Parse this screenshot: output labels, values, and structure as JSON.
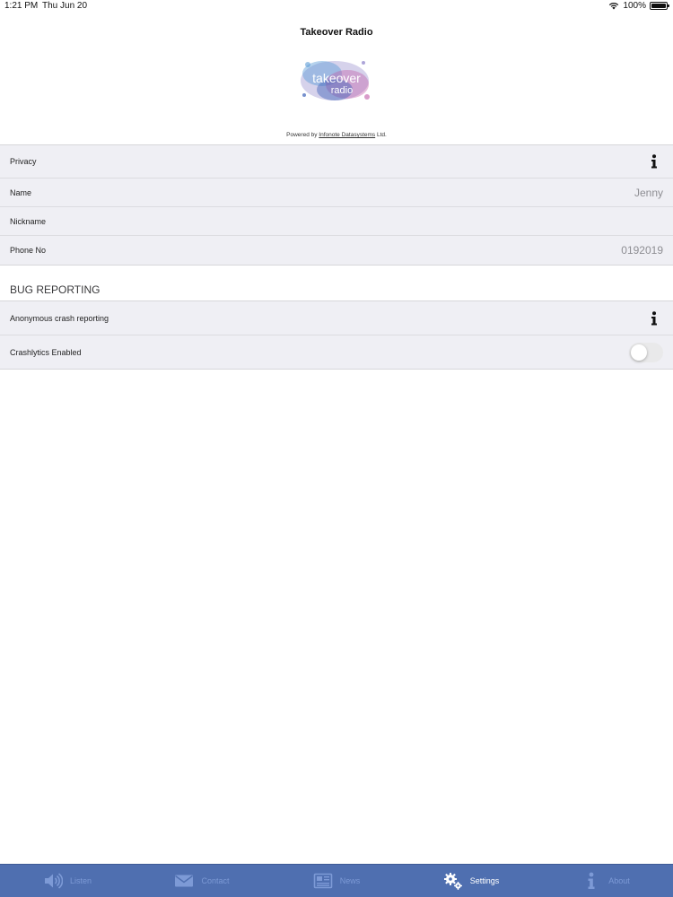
{
  "status_bar": {
    "time": "1:21 PM",
    "date": "Thu Jun 20",
    "battery": "100%"
  },
  "header": {
    "title": "Takeover Radio",
    "logo_text_line1": "takeover",
    "logo_text_line2": "radio",
    "powered_prefix": "Powered by ",
    "powered_link": "Infonote Datasystems",
    "powered_suffix": " Ltd."
  },
  "settings": {
    "privacy_label": "Privacy",
    "name_label": "Name",
    "name_value": "Jenny",
    "nickname_label": "Nickname",
    "nickname_value": "",
    "phone_label": "Phone No",
    "phone_value": "0192019"
  },
  "bug_reporting": {
    "section_title": "BUG REPORTING",
    "anonymous_label": "Anonymous crash reporting",
    "crashlytics_label": "Crashlytics Enabled",
    "crashlytics_enabled": false
  },
  "tab_bar": {
    "active_tab": "Settings",
    "tabs": [
      {
        "label": "Listen",
        "icon": "speaker-icon"
      },
      {
        "label": "Contact",
        "icon": "envelope-icon"
      },
      {
        "label": "News",
        "icon": "newspaper-icon"
      },
      {
        "label": "Settings",
        "icon": "gears-icon"
      },
      {
        "label": "About",
        "icon": "info-icon"
      }
    ]
  },
  "colors": {
    "tab_bar_bg": "#4f6fb0",
    "tab_inactive": "#7d9ad6",
    "tab_active": "#ffffff",
    "group_bg": "#efeff4"
  }
}
